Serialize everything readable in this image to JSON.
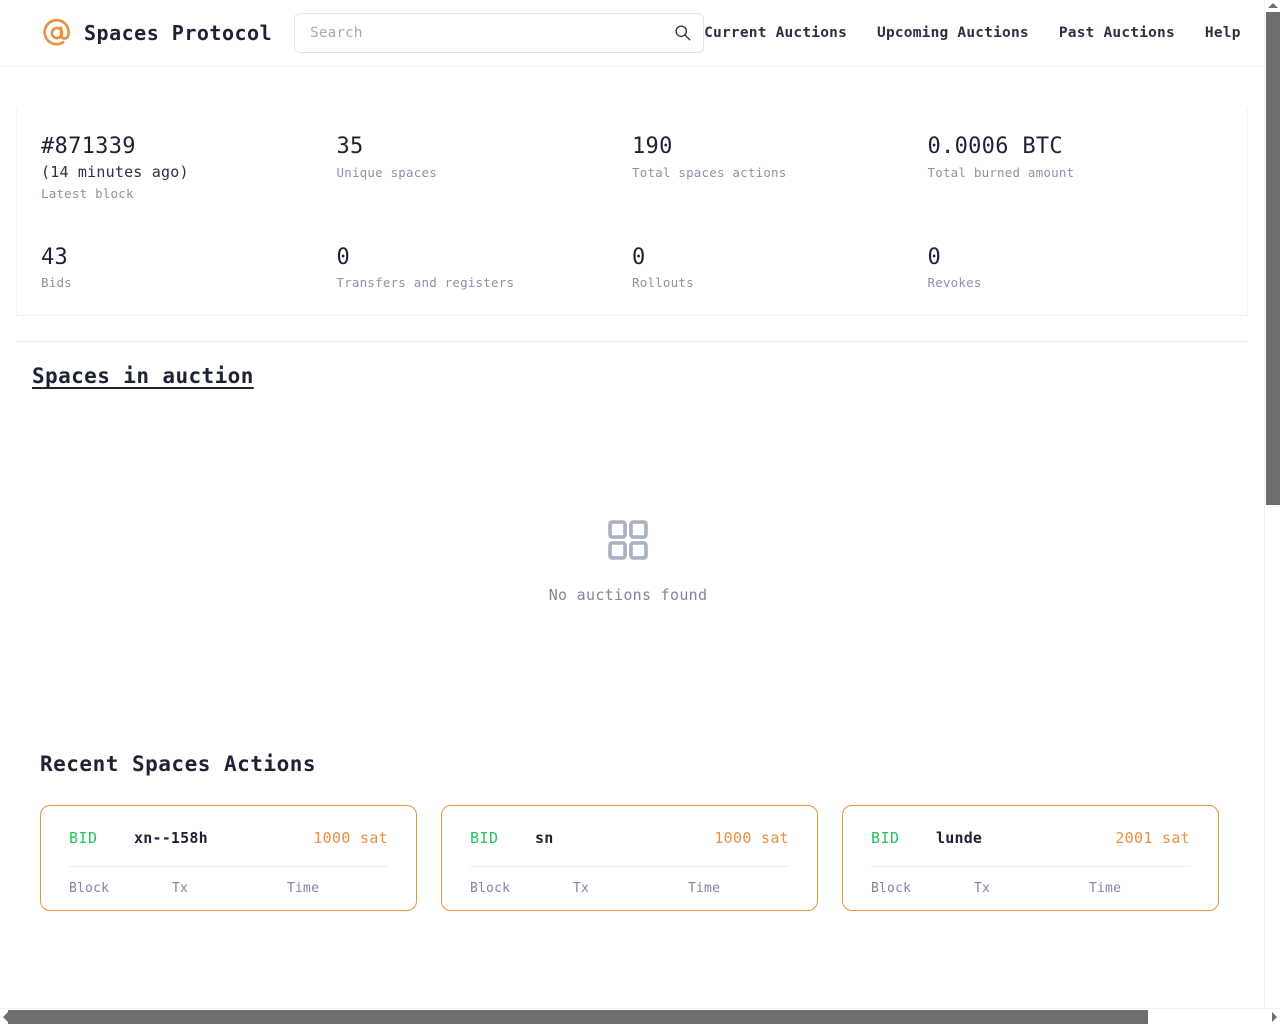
{
  "header": {
    "logo_icon": "at-sign-icon",
    "brand": "Spaces Protocol",
    "search": {
      "placeholder": "Search",
      "value": "",
      "icon": "search-icon"
    },
    "nav": [
      {
        "label": "Current Auctions"
      },
      {
        "label": "Upcoming Auctions"
      },
      {
        "label": "Past Auctions"
      },
      {
        "label": "Help"
      }
    ]
  },
  "stats": [
    {
      "value": "#871339",
      "sub": "(14 minutes ago)",
      "label": "Latest block"
    },
    {
      "value": "35",
      "sub": "",
      "label": "Unique spaces"
    },
    {
      "value": "190",
      "sub": "",
      "label": "Total spaces actions"
    },
    {
      "value": "0.0006 BTC",
      "sub": "",
      "label": "Total burned amount"
    },
    {
      "value": "43",
      "sub": "",
      "label": "Bids"
    },
    {
      "value": "0",
      "sub": "",
      "label": "Transfers and registers"
    },
    {
      "value": "0",
      "sub": "",
      "label": "Rollouts"
    },
    {
      "value": "0",
      "sub": "",
      "label": "Revokes"
    }
  ],
  "auctions": {
    "title": "Spaces in auction",
    "empty_icon": "grid-squares-icon",
    "empty_text": "No auctions found"
  },
  "recent": {
    "title": "Recent Spaces Actions",
    "meta_headers": {
      "block": "Block",
      "tx": "Tx",
      "time": "Time"
    },
    "cards": [
      {
        "kind": "BID",
        "space": "xn--158h",
        "amount": "1000 sat"
      },
      {
        "kind": "BID",
        "space": "sn",
        "amount": "1000 sat"
      },
      {
        "kind": "BID",
        "space": "lunde",
        "amount": "2001 sat"
      }
    ]
  },
  "colors": {
    "accent_orange": "#e8913f",
    "bid_green": "#22c55e",
    "text_dark": "#1e2235",
    "text_muted": "#8b93a8",
    "scrollbar": "#6e6e6e"
  }
}
